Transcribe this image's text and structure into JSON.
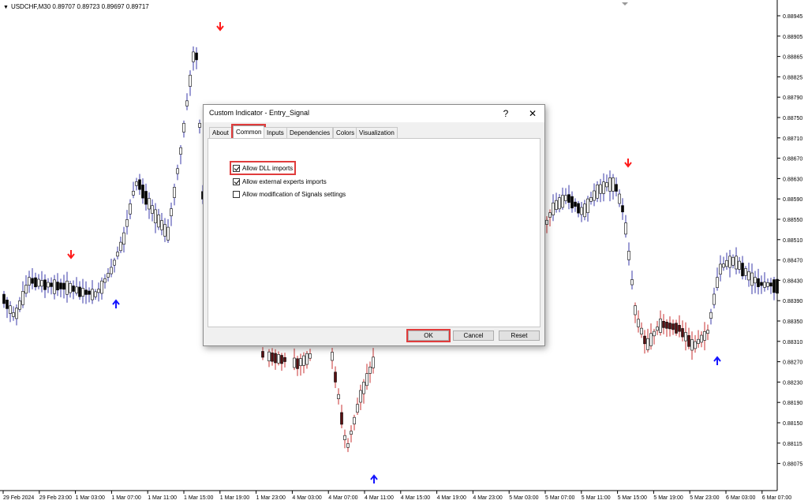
{
  "chart": {
    "symbol_label": "USDCHF,M30  0.89707 0.89723 0.89697 0.89717",
    "price_labels": [
      "0.88945",
      "0.88905",
      "0.88865",
      "0.88825",
      "0.88790",
      "0.88750",
      "0.88710",
      "0.88670",
      "0.88630",
      "0.88590",
      "0.88550",
      "0.88510",
      "0.88470",
      "0.88430",
      "0.88390",
      "0.88350",
      "0.88310",
      "0.88270",
      "0.88230",
      "0.88190",
      "0.88150",
      "0.88115",
      "0.88075"
    ],
    "time_labels": [
      "29 Feb 2024",
      "29 Feb 23:00",
      "1 Mar 03:00",
      "1 Mar 07:00",
      "1 Mar 11:00",
      "1 Mar 15:00",
      "1 Mar 19:00",
      "1 Mar 23:00",
      "4 Mar 03:00",
      "4 Mar 07:00",
      "4 Mar 11:00",
      "4 Mar 15:00",
      "4 Mar 19:00",
      "4 Mar 23:00",
      "5 Mar 03:00",
      "5 Mar 07:00",
      "5 Mar 11:00",
      "5 Mar 15:00",
      "5 Mar 19:00",
      "5 Mar 23:00",
      "6 Mar 03:00",
      "6 Mar 07:00"
    ],
    "colors": {
      "bull": "#3a3aa8",
      "bear": "#c83232",
      "body_dark": "#000000",
      "body_maroon": "#5a0f12",
      "arrow_up": "#1515ff",
      "arrow_down": "#ff1a1a",
      "highlight": "#e03c3c"
    },
    "signals": [
      "sell-arrow",
      "buy-arrow",
      "sell-arrow",
      "buy-arrow",
      "sell-arrow",
      "buy-arrow"
    ]
  },
  "dialog": {
    "title": "Custom Indicator - Entry_Signal",
    "help_label": "?",
    "close_label": "✕",
    "tabs": [
      {
        "label": "About"
      },
      {
        "label": "Common"
      },
      {
        "label": "Inputs"
      },
      {
        "label": "Dependencies"
      },
      {
        "label": "Colors"
      },
      {
        "label": "Visualization"
      }
    ],
    "active_tab": "Common",
    "options": [
      {
        "label": "Allow DLL imports",
        "checked": true
      },
      {
        "label": "Allow external experts imports",
        "checked": true
      },
      {
        "label": "Allow modification of Signals settings",
        "checked": false
      }
    ],
    "buttons": {
      "ok": "OK",
      "cancel": "Cancel",
      "reset": "Reset"
    }
  }
}
